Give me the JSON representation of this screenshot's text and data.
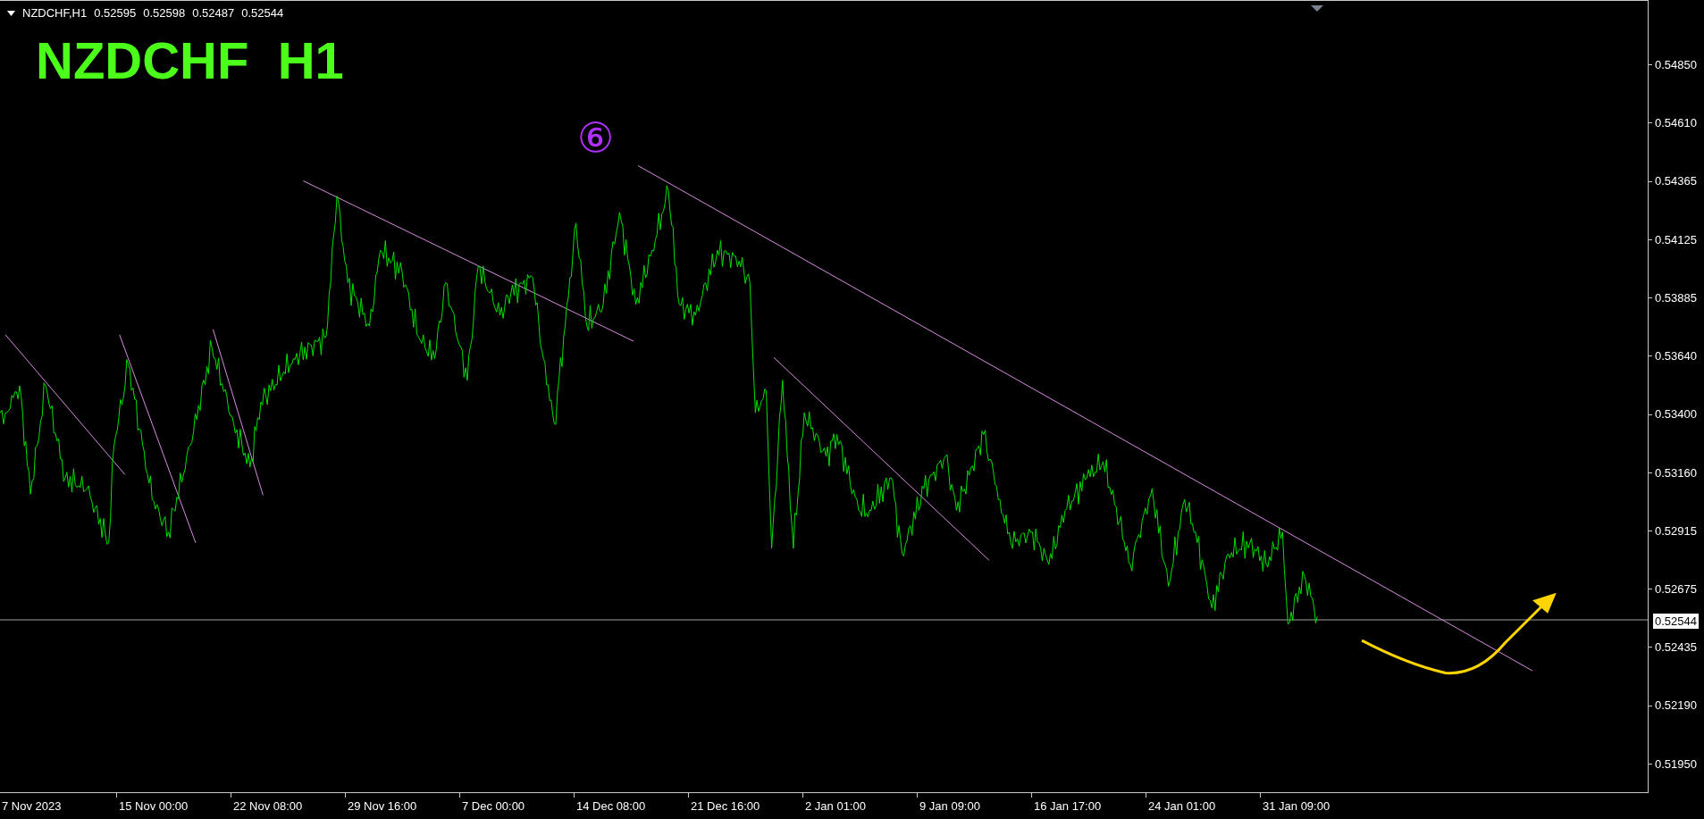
{
  "header": {
    "symbol": "NZDCHF,H1",
    "prices": [
      "0.52595",
      "0.52598",
      "0.52487",
      "0.52544"
    ]
  },
  "chart_title": "NZDCHF  H1",
  "annotation": "⑥",
  "price_axis": [
    "0.54850",
    "0.54610",
    "0.54365",
    "0.54125",
    "0.53885",
    "0.53640",
    "0.53400",
    "0.53160",
    "0.52915",
    "0.52675",
    "0.52435",
    "0.52190",
    "0.51950"
  ],
  "current_price": "0.52544",
  "time_axis": [
    "7 Nov 2023",
    "15 Nov 00:00",
    "22 Nov 08:00",
    "29 Nov 16:00",
    "7 Dec 00:00",
    "14 Dec 08:00",
    "21 Dec 16:00",
    "2 Jan 01:00",
    "9 Jan 09:00",
    "16 Jan 17:00",
    "24 Jan 01:00",
    "31 Jan 09:00"
  ]
}
